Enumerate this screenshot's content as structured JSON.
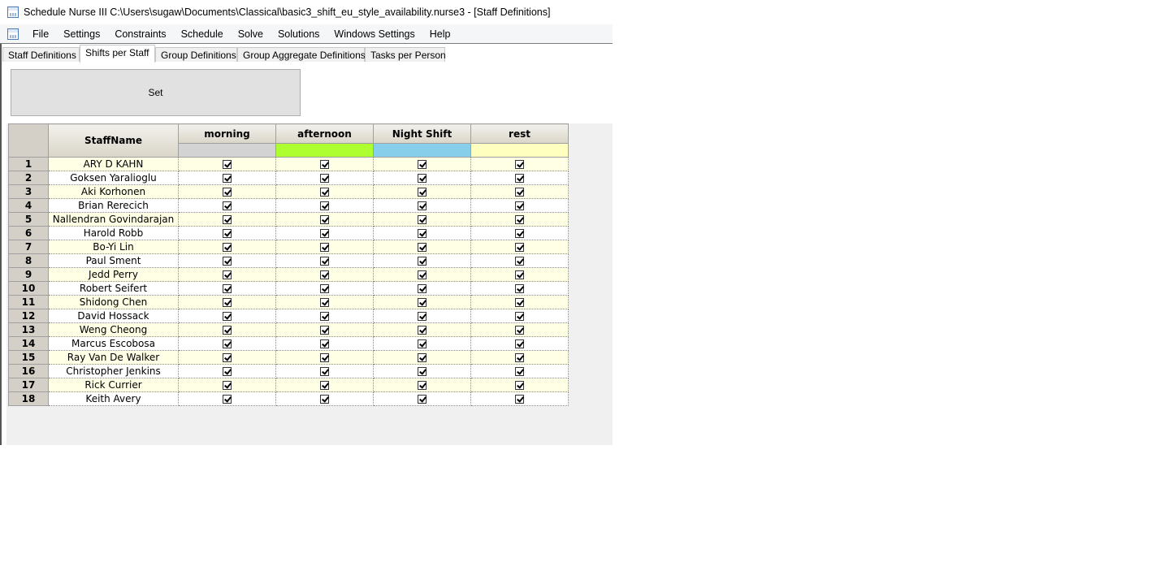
{
  "window": {
    "title": "Schedule Nurse III   C:\\Users\\sugaw\\Documents\\Classical\\basic3_shift_eu_style_availability.nurse3 - [Staff Definitions]"
  },
  "menu": [
    "File",
    "Settings",
    "Constraints",
    "Schedule",
    "Solve",
    "Solutions",
    "Windows Settings",
    "Help"
  ],
  "tabs": [
    {
      "label": "Staff Definitions",
      "active": false
    },
    {
      "label": "Shifts per Staff",
      "active": true
    },
    {
      "label": "Group Definitions",
      "active": false
    },
    {
      "label": "Group Aggregate Definitions",
      "active": false
    },
    {
      "label": "Tasks per Person",
      "active": false
    }
  ],
  "set_button": "Set",
  "grid": {
    "name_header": "StaffName",
    "shifts": [
      {
        "label": "morning",
        "color": "#d3d3d3"
      },
      {
        "label": "afternoon",
        "color": "#adff2f"
      },
      {
        "label": "Night Shift",
        "color": "#87ceeb"
      },
      {
        "label": "rest",
        "color": "#ffffc0"
      }
    ],
    "rows": [
      {
        "num": "1",
        "name": "ARY D KAHN"
      },
      {
        "num": "2",
        "name": "Goksen Yaralioglu"
      },
      {
        "num": "3",
        "name": "Aki Korhonen"
      },
      {
        "num": "4",
        "name": "Brian Rerecich"
      },
      {
        "num": "5",
        "name": "Nallendran Govindarajan"
      },
      {
        "num": "6",
        "name": "Harold Robb"
      },
      {
        "num": "7",
        "name": "Bo-Yi Lin"
      },
      {
        "num": "8",
        "name": "Paul Sment"
      },
      {
        "num": "9",
        "name": "Jedd Perry"
      },
      {
        "num": "10",
        "name": "Robert Seifert"
      },
      {
        "num": "11",
        "name": "Shidong Chen"
      },
      {
        "num": "12",
        "name": "David Hossack"
      },
      {
        "num": "13",
        "name": "Weng Cheong"
      },
      {
        "num": "14",
        "name": "Marcus Escobosa"
      },
      {
        "num": "15",
        "name": "Ray Van De Walker"
      },
      {
        "num": "16",
        "name": "Christopher Jenkins"
      },
      {
        "num": "17",
        "name": "Rick Currier"
      },
      {
        "num": "18",
        "name": "Keith Avery"
      }
    ],
    "checked": true
  }
}
